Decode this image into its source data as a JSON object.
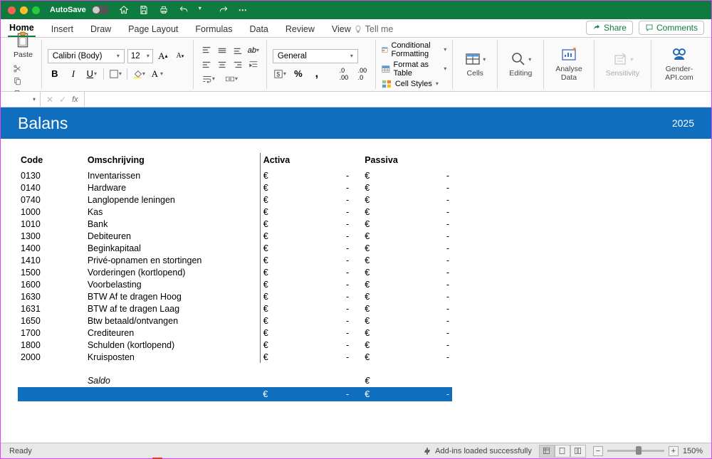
{
  "titlebar": {
    "autosave_label": "AutoSave",
    "autosave_state": "OFF"
  },
  "tabs": {
    "items": [
      "Home",
      "Insert",
      "Draw",
      "Page Layout",
      "Formulas",
      "Data",
      "Review",
      "View"
    ],
    "active": 0,
    "tellme": "Tell me"
  },
  "share": {
    "share_label": "Share",
    "comments_label": "Comments"
  },
  "ribbon": {
    "paste_label": "Paste",
    "font_name": "Calibri (Body)",
    "font_size": "12",
    "number_format": "General",
    "cond_fmt": "Conditional Formatting",
    "fmt_table": "Format as Table",
    "cell_styles": "Cell Styles",
    "cells_label": "Cells",
    "editing_label": "Editing",
    "analyse_line1": "Analyse",
    "analyse_line2": "Data",
    "sensitivity_label": "Sensitivity",
    "gender_label": "Gender-API.com"
  },
  "sheet": {
    "title": "Balans",
    "year": "2025",
    "headers": {
      "code": "Code",
      "desc": "Omschrijving",
      "activa": "Activa",
      "passiva": "Passiva"
    },
    "rows": [
      {
        "code": "0130",
        "desc": "Inventarissen",
        "act": "-",
        "pas": "-"
      },
      {
        "code": "0140",
        "desc": "Hardware",
        "act": "-",
        "pas": "-"
      },
      {
        "code": "0740",
        "desc": "Langlopende leningen",
        "act": "-",
        "pas": "-"
      },
      {
        "code": "1000",
        "desc": "Kas",
        "act": "-",
        "pas": "-"
      },
      {
        "code": "1010",
        "desc": "Bank",
        "act": "-",
        "pas": "-"
      },
      {
        "code": "1300",
        "desc": "Debiteuren",
        "act": "-",
        "pas": "-"
      },
      {
        "code": "1400",
        "desc": "Beginkapitaal",
        "act": "-",
        "pas": "-"
      },
      {
        "code": "1410",
        "desc": "Privé-opnamen en stortingen",
        "act": "-",
        "pas": "-"
      },
      {
        "code": "1500",
        "desc": "Vorderingen (kortlopend)",
        "act": "-",
        "pas": "-"
      },
      {
        "code": "1600",
        "desc": "Voorbelasting",
        "act": "-",
        "pas": "-"
      },
      {
        "code": "1630",
        "desc": "BTW Af te dragen Hoog",
        "act": "-",
        "pas": "-"
      },
      {
        "code": "1631",
        "desc": "BTW af te dragen Laag",
        "act": "-",
        "pas": "-"
      },
      {
        "code": "1650",
        "desc": "Btw betaald/ontvangen",
        "act": "-",
        "pas": "-"
      },
      {
        "code": "1700",
        "desc": "Crediteuren",
        "act": "-",
        "pas": "-"
      },
      {
        "code": "1800",
        "desc": "Schulden (kortlopend)",
        "act": "-",
        "pas": "-"
      },
      {
        "code": "2000",
        "desc": "Kruisposten",
        "act": "-",
        "pas": "-"
      }
    ],
    "saldo_label": "Saldo",
    "euro": "€",
    "total_act": "-",
    "total_pas": "-"
  },
  "status": {
    "ready": "Ready",
    "addins": "Add-ins loaded successfully",
    "zoom": "150%"
  }
}
